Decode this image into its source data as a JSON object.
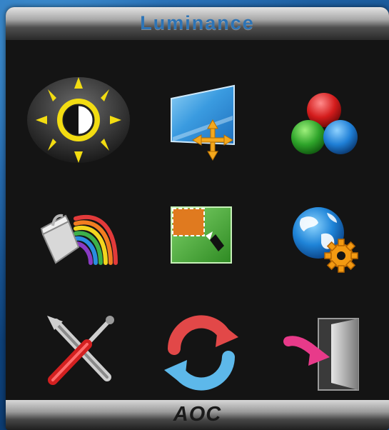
{
  "menu": {
    "title": "Luminance",
    "brand": "AOC",
    "items": [
      {
        "icon": "luminance-icon",
        "selected": true
      },
      {
        "icon": "image-setup-icon"
      },
      {
        "icon": "color-setup-icon"
      },
      {
        "icon": "picture-boost-icon"
      },
      {
        "icon": "osd-setup-icon"
      },
      {
        "icon": "extra-icon"
      },
      {
        "icon": "factory-reset-icon"
      },
      {
        "icon": "reset-icon"
      },
      {
        "icon": "exit-icon"
      }
    ]
  },
  "colors": {
    "title": "#2d74b6",
    "panel": "#141414",
    "sun": "#f2dc12"
  }
}
